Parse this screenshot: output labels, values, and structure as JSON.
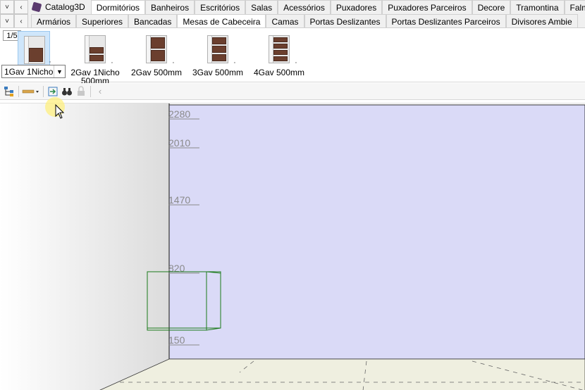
{
  "row1": {
    "nav_down": "˅",
    "nav_left": "‹",
    "app_name": "Catalog3D",
    "tabs": [
      "Dormitórios",
      "Banheiros",
      "Escritórios",
      "Salas",
      "Acessórios",
      "Puxadores",
      "Puxadores Parceiros",
      "Decore",
      "Tramontina",
      "Falmec"
    ],
    "active_index": 0
  },
  "row2": {
    "nav_down": "˅",
    "nav_left": "‹",
    "tabs": [
      "Armários",
      "Superiores",
      "Bancadas",
      "Mesas de Cabeceira",
      "Camas",
      "Portas Deslizantes",
      "Portas Deslizantes Parceiros",
      "Divisores Ambie"
    ],
    "active_index": 3
  },
  "catalog": {
    "page": "1/5",
    "items": [
      {
        "label": "",
        "drawers": 1,
        "niche": true
      },
      {
        "label": "2Gav 1Nicho 500mm",
        "drawers": 2,
        "niche": true
      },
      {
        "label": "2Gav 500mm",
        "drawers": 2,
        "niche": false
      },
      {
        "label": "3Gav 500mm",
        "drawers": 3,
        "niche": false
      },
      {
        "label": "4Gav 500mm",
        "drawers": 4,
        "niche": false
      }
    ],
    "selected_value": "1Gav 1Nicho :"
  },
  "toolbar": {
    "icons": [
      "hierarchy-icon",
      "ruler-dropdown-icon",
      "export-icon",
      "binoculars-icon",
      "lock-icon",
      "back-arrow-icon"
    ]
  },
  "viewport": {
    "wall_color": "#dadaf7",
    "dimensions": [
      "2280",
      "2010",
      "1470",
      "820",
      "150"
    ]
  }
}
